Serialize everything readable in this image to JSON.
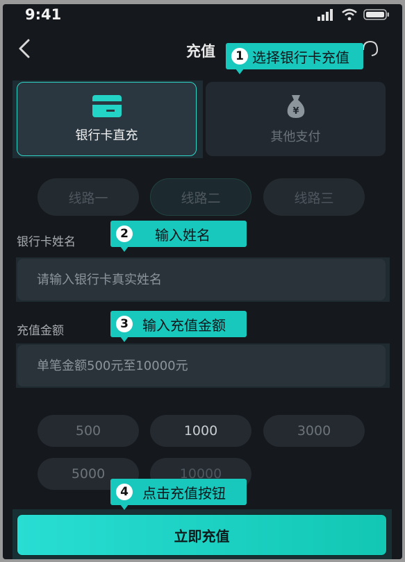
{
  "status_bar": {
    "time": "9:41"
  },
  "nav": {
    "title": "充值"
  },
  "callouts": [
    {
      "num": "1",
      "text": "选择银行卡充值"
    },
    {
      "num": "2",
      "text": "输入姓名"
    },
    {
      "num": "3",
      "text": "输入充值金额"
    },
    {
      "num": "4",
      "text": "点击充值按钮"
    }
  ],
  "pay_methods": [
    {
      "label": "银行卡直充",
      "icon": "bank-card-icon",
      "selected": true
    },
    {
      "label": "其他支付",
      "icon": "money-bag-icon",
      "selected": false
    }
  ],
  "routes": [
    {
      "label": "线路一",
      "selected": false
    },
    {
      "label": "线路二",
      "selected": true
    },
    {
      "label": "线路三",
      "selected": false
    }
  ],
  "name_field": {
    "label": "银行卡姓名",
    "placeholder": "请输入银行卡真实姓名"
  },
  "amount_field": {
    "label": "充值金额",
    "placeholder": "单笔金额500元至10000元"
  },
  "quick_amounts": [
    "500",
    "1000",
    "3000",
    "5000",
    "10000"
  ],
  "submit_label": "立即充值",
  "colors": {
    "accent": "#19c8bd",
    "background": "#15181d",
    "card": "#2a3640"
  }
}
